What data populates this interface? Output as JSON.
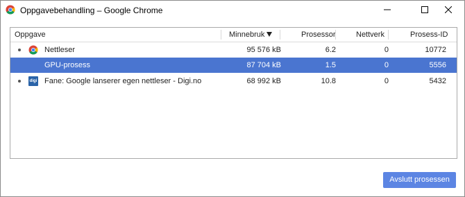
{
  "window": {
    "title": "Oppgavebehandling – Google Chrome",
    "icon": "chrome-logo-icon"
  },
  "table": {
    "columns": [
      {
        "label": "Oppgave"
      },
      {
        "label": "Minnebruk",
        "sorted": "descending"
      },
      {
        "label": "Prosessor"
      },
      {
        "label": "Nettverk"
      },
      {
        "label": "Prosess-ID"
      }
    ],
    "rows": [
      {
        "icon": "chrome-logo-icon",
        "task": "Nettleser",
        "memory": "95 576 kB",
        "cpu": "6.2",
        "network": "0",
        "pid": "10772",
        "selected": false
      },
      {
        "icon": "none",
        "task": "GPU-prosess",
        "memory": "87 704 kB",
        "cpu": "1.5",
        "network": "0",
        "pid": "5556",
        "selected": true
      },
      {
        "icon": "digi-favicon-icon",
        "icon_text": "digi",
        "task": "Fane: Google lanserer egen nettleser - Digi.no",
        "memory": "68 992 kB",
        "cpu": "10.8",
        "network": "0",
        "pid": "5432",
        "selected": false
      }
    ]
  },
  "end_process_label": "Avslutt prosessen",
  "colors": {
    "selection": "#4a75d0",
    "button": "#5c85e3"
  }
}
